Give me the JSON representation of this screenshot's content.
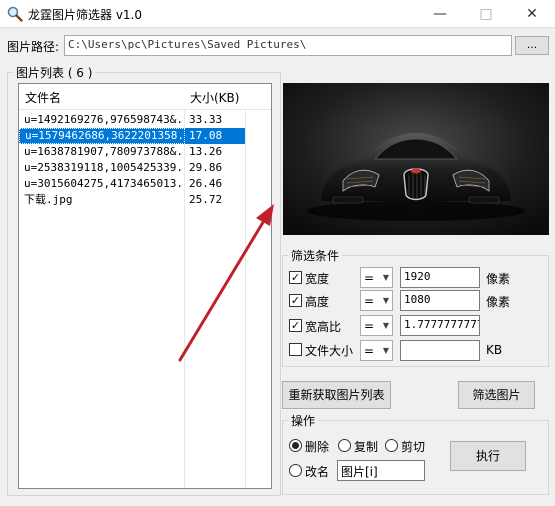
{
  "window": {
    "title": "龙霆图片筛选器 v1.0",
    "minimize": "—",
    "maximize": "□",
    "close": "✕"
  },
  "path": {
    "label": "图片路径:",
    "value": "C:\\Users\\pc\\Pictures\\Saved Pictures\\",
    "browse_label": "..."
  },
  "list": {
    "group_title": "图片列表 ( 6 )",
    "columns": [
      "文件名",
      "大小(KB)"
    ],
    "rows": [
      {
        "name": "u=1492169276,976598743&...",
        "size": "33.33",
        "selected": false
      },
      {
        "name": "u=1579462686,3622201358...",
        "size": "17.08",
        "selected": true
      },
      {
        "name": "u=1638781907,780973788&...",
        "size": "13.26",
        "selected": false
      },
      {
        "name": "u=2538319118,1005425339...",
        "size": "29.86",
        "selected": false
      },
      {
        "name": "u=3015604275,4173465013...",
        "size": "26.46",
        "selected": false
      },
      {
        "name": "下载.jpg",
        "size": "25.72",
        "selected": false
      }
    ]
  },
  "filter": {
    "group_title": "筛选条件",
    "width": {
      "label": "宽度",
      "checked": true,
      "op": "=",
      "value": "1920",
      "unit": "像素"
    },
    "height": {
      "label": "高度",
      "checked": true,
      "op": "=",
      "value": "1080",
      "unit": "像素"
    },
    "ratio": {
      "label": "宽高比",
      "checked": true,
      "op": "=",
      "value": "1.7777777777"
    },
    "filesize": {
      "label": "文件大小",
      "checked": false,
      "op": "=",
      "value": "",
      "unit": "KB"
    }
  },
  "buttons": {
    "reload": "重新获取图片列表",
    "filter": "筛选图片",
    "execute": "执行"
  },
  "ops": {
    "group_title": "操作",
    "delete": "删除",
    "copy": "复制",
    "cut": "剪切",
    "rename": "改名",
    "rename_value": "图片[i]",
    "selected": "delete"
  }
}
